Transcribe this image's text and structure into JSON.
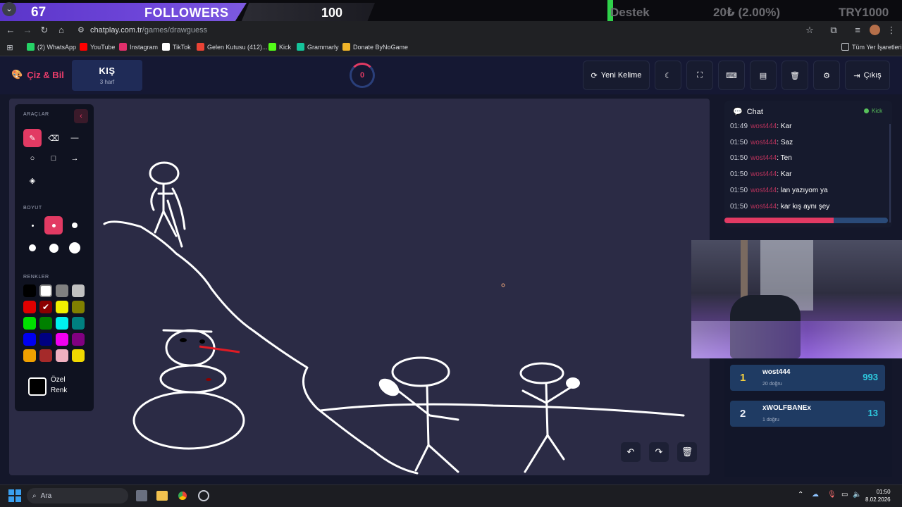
{
  "overlay": {
    "followers_count": "67",
    "followers_label": "FOLLOWERS",
    "followers_goal": "100",
    "support_label": "Destek",
    "support_amount": "20₺ (2.00%)",
    "support_target": "TRY1000"
  },
  "browser": {
    "url_domain": "chatplay.com.tr",
    "url_path": "/games/drawguess",
    "bookmarks": [
      {
        "label": "(2) WhatsApp",
        "color": "#25d366"
      },
      {
        "label": "YouTube",
        "color": "#ff0000"
      },
      {
        "label": "Instagram",
        "color": "#e1306c"
      },
      {
        "label": "TikTok",
        "color": "#ffffff"
      },
      {
        "label": "Gelen Kutusu (412)...",
        "color": "#ea4335"
      },
      {
        "label": "Kick",
        "color": "#53fc18"
      },
      {
        "label": "Grammarly",
        "color": "#15c39a"
      },
      {
        "label": "Donate ByNoGame",
        "color": "#f0b429"
      }
    ],
    "all_bookmarks": "Tüm Yer İşaretleri"
  },
  "header": {
    "brand": "Çiz & Bil",
    "word": "KIŞ",
    "word_hint": "3 harf",
    "timer": "0",
    "new_word": "Yeni Kelime",
    "exit": "Çıkış"
  },
  "tools": {
    "tools_label": "ARAÇLAR",
    "size_label": "BOYUT",
    "colors_label": "RENKLER",
    "custom_color_line1": "Özel",
    "custom_color_line2": "Renk",
    "colors": [
      "#000000",
      "#ffffff",
      "#808080",
      "#c0c0c0",
      "#e00000",
      "#8b0000",
      "#f0f000",
      "#808000",
      "#00e000",
      "#008000",
      "#00f0f0",
      "#008080",
      "#0000f0",
      "#000080",
      "#f000f0",
      "#800080",
      "#f0a000",
      "#a52a2a",
      "#f0b0c0",
      "#f0d800"
    ]
  },
  "chat": {
    "title": "Chat",
    "status": "Kick",
    "messages": [
      {
        "time": "01:49",
        "user": "wost444",
        "text": ": Kar"
      },
      {
        "time": "01:50",
        "user": "wost444",
        "text": ": Saz"
      },
      {
        "time": "01:50",
        "user": "wost444",
        "text": ": Ten"
      },
      {
        "time": "01:50",
        "user": "wost444",
        "text": ": Kar"
      },
      {
        "time": "01:50",
        "user": "wost444",
        "text": ": lan yazıyom ya"
      },
      {
        "time": "01:50",
        "user": "wost444",
        "text": ": kar kış aynı şey"
      }
    ],
    "progress": 0.67
  },
  "leaderboard": [
    {
      "rank": "1",
      "name": "wost444",
      "sub": "20 doğru",
      "score": "993",
      "rank_color": "#f4d03f"
    },
    {
      "rank": "2",
      "name": "xWOLFBANEx",
      "sub": "1 doğru",
      "score": "13",
      "rank_color": "#e8ecf5"
    }
  ],
  "taskbar": {
    "search": "Ara",
    "time": "01:50",
    "date": "8.02.2026"
  }
}
